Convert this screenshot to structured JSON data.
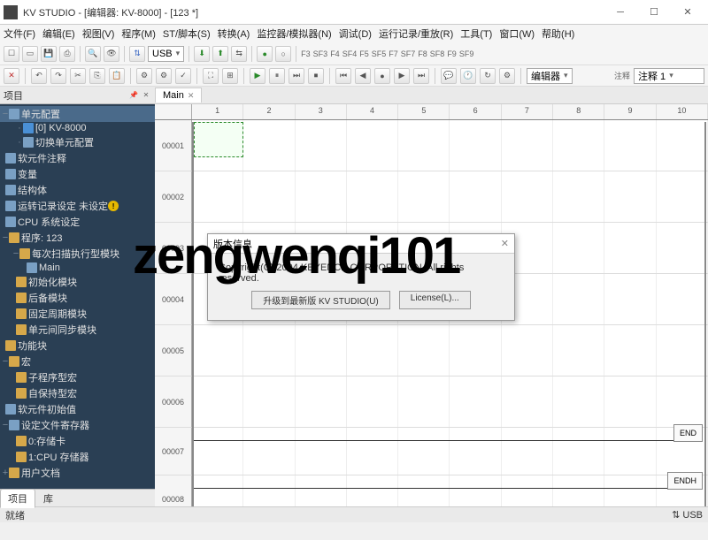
{
  "window": {
    "title": "KV STUDIO - [编辑器: KV-8000] - [123 *]"
  },
  "menus": [
    "文件(F)",
    "编辑(E)",
    "视图(V)",
    "程序(M)",
    "ST/脚本(S)",
    "转换(A)",
    "监控器/模拟器(N)",
    "调试(D)",
    "运行记录/重放(R)",
    "工具(T)",
    "窗口(W)",
    "帮助(H)"
  ],
  "toolbar1": {
    "usb": "USB",
    "sf_labels": [
      "F3",
      "SF3",
      "F4",
      "SF4",
      "F5",
      "SF5",
      "F7",
      "SF7",
      "F8",
      "SF8",
      "F9",
      "SF9"
    ]
  },
  "toolbar2": {
    "mode": "编辑器",
    "comment_label": "注释",
    "comment_sel": "注释 1"
  },
  "sidebar": {
    "title": "项目",
    "tabs": [
      "项目",
      "库"
    ],
    "root": "单元配置",
    "nodes": {
      "n0": "[0] KV-8000",
      "n1": "切换单元配置",
      "n2": "软元件注释",
      "n3": "变量",
      "n4": "结构体",
      "n5": "运转记录设定 未设定",
      "n6": "CPU 系统设定",
      "n7": "程序: 123",
      "n7_0": "每次扫描执行型模块",
      "n7_0_0": "Main",
      "n7_1": "初始化模块",
      "n7_2": "后备模块",
      "n7_3": "固定周期模块",
      "n7_4": "单元间同步模块",
      "n8": "功能块",
      "n9": "宏",
      "n9_0": "子程序型宏",
      "n9_1": "自保持型宏",
      "n10": "软元件初始值",
      "n11": "设定文件寄存器",
      "n11_0": "0:存储卡",
      "n11_1": "1:CPU 存储器",
      "n12": "用户文档"
    }
  },
  "editor": {
    "tab": "Main",
    "cols": [
      "1",
      "2",
      "3",
      "4",
      "5",
      "6",
      "7",
      "8",
      "9",
      "10"
    ],
    "rows": [
      "00001",
      "00002",
      "00003",
      "00004",
      "00005",
      "00006",
      "00007",
      "00008"
    ],
    "end1": "END",
    "end2": "ENDH"
  },
  "dialog": {
    "title": "版本信息",
    "copyright": "Copyright(C) 2004 KEYENCE CORPORATION. All rights reserved.",
    "btn1": "升级到最新版 KV STUDIO(U)",
    "btn2": "License(L)..."
  },
  "status": {
    "left": "就绪",
    "right": "USB"
  },
  "watermark": "zengwenqi101"
}
